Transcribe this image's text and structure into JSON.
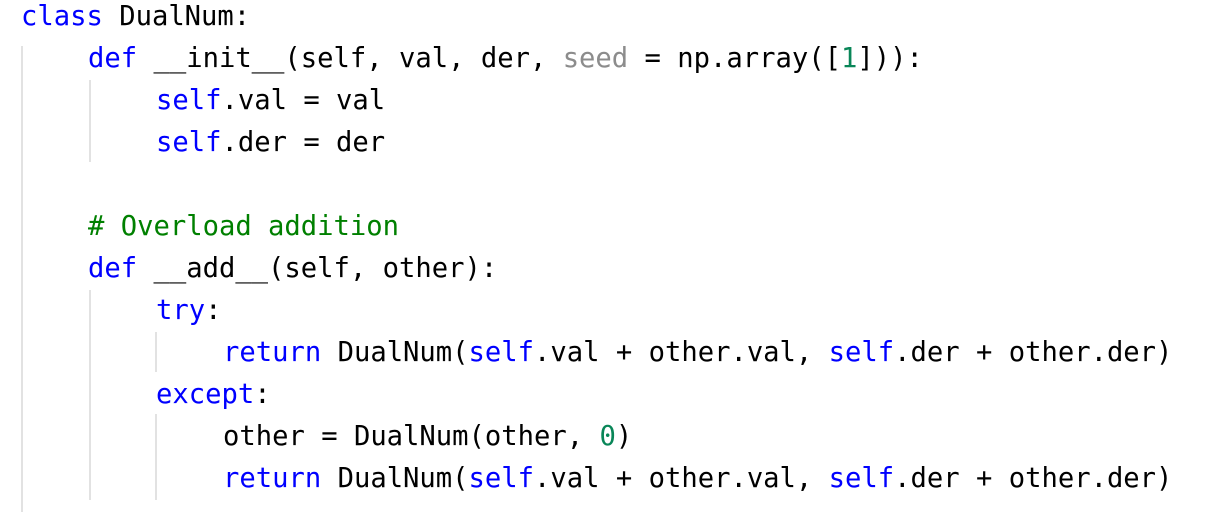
{
  "code": {
    "lines": [
      [
        {
          "t": "class",
          "s": "kw"
        },
        {
          "t": " DualNum:",
          "s": ""
        }
      ],
      [
        {
          "t": "def",
          "s": "kw"
        },
        {
          "t": " __init__(self, val, der, ",
          "s": ""
        },
        {
          "t": "seed",
          "s": "dflt"
        },
        {
          "t": " = np.array([",
          "s": ""
        },
        {
          "t": "1",
          "s": "num"
        },
        {
          "t": "])):",
          "s": ""
        }
      ],
      [
        {
          "t": "self",
          "s": "slf"
        },
        {
          "t": ".val = val",
          "s": ""
        }
      ],
      [
        {
          "t": "self",
          "s": "slf"
        },
        {
          "t": ".der = der",
          "s": ""
        }
      ],
      [],
      [
        {
          "t": "# Overload addition",
          "s": "cm"
        }
      ],
      [
        {
          "t": "def",
          "s": "kw"
        },
        {
          "t": " __add__(self, other):",
          "s": ""
        }
      ],
      [
        {
          "t": "try",
          "s": "kw"
        },
        {
          "t": ":",
          "s": ""
        }
      ],
      [
        {
          "t": "return",
          "s": "kw"
        },
        {
          "t": " DualNum(",
          "s": ""
        },
        {
          "t": "self",
          "s": "slf"
        },
        {
          "t": ".val + other.val, ",
          "s": ""
        },
        {
          "t": "self",
          "s": "slf"
        },
        {
          "t": ".der + other.der)",
          "s": ""
        }
      ],
      [
        {
          "t": "except",
          "s": "kw"
        },
        {
          "t": ":",
          "s": ""
        }
      ],
      [
        {
          "t": "other = DualNum(other, ",
          "s": ""
        },
        {
          "t": "0",
          "s": "num"
        },
        {
          "t": ")",
          "s": ""
        }
      ],
      [
        {
          "t": "return",
          "s": "kw"
        },
        {
          "t": " DualNum(",
          "s": ""
        },
        {
          "t": "self",
          "s": "slf"
        },
        {
          "t": ".val + other.val, ",
          "s": ""
        },
        {
          "t": "self",
          "s": "slf"
        },
        {
          "t": ".der + other.der)",
          "s": ""
        }
      ]
    ]
  },
  "colors": {
    "keyword": "#0000ff",
    "self": "#0000ff",
    "comment": "#008000",
    "number": "#098658",
    "default_param": "#8c8c8c",
    "text": "#000000",
    "indent_guide": "#e2e2e2",
    "background": "#ffffff"
  }
}
